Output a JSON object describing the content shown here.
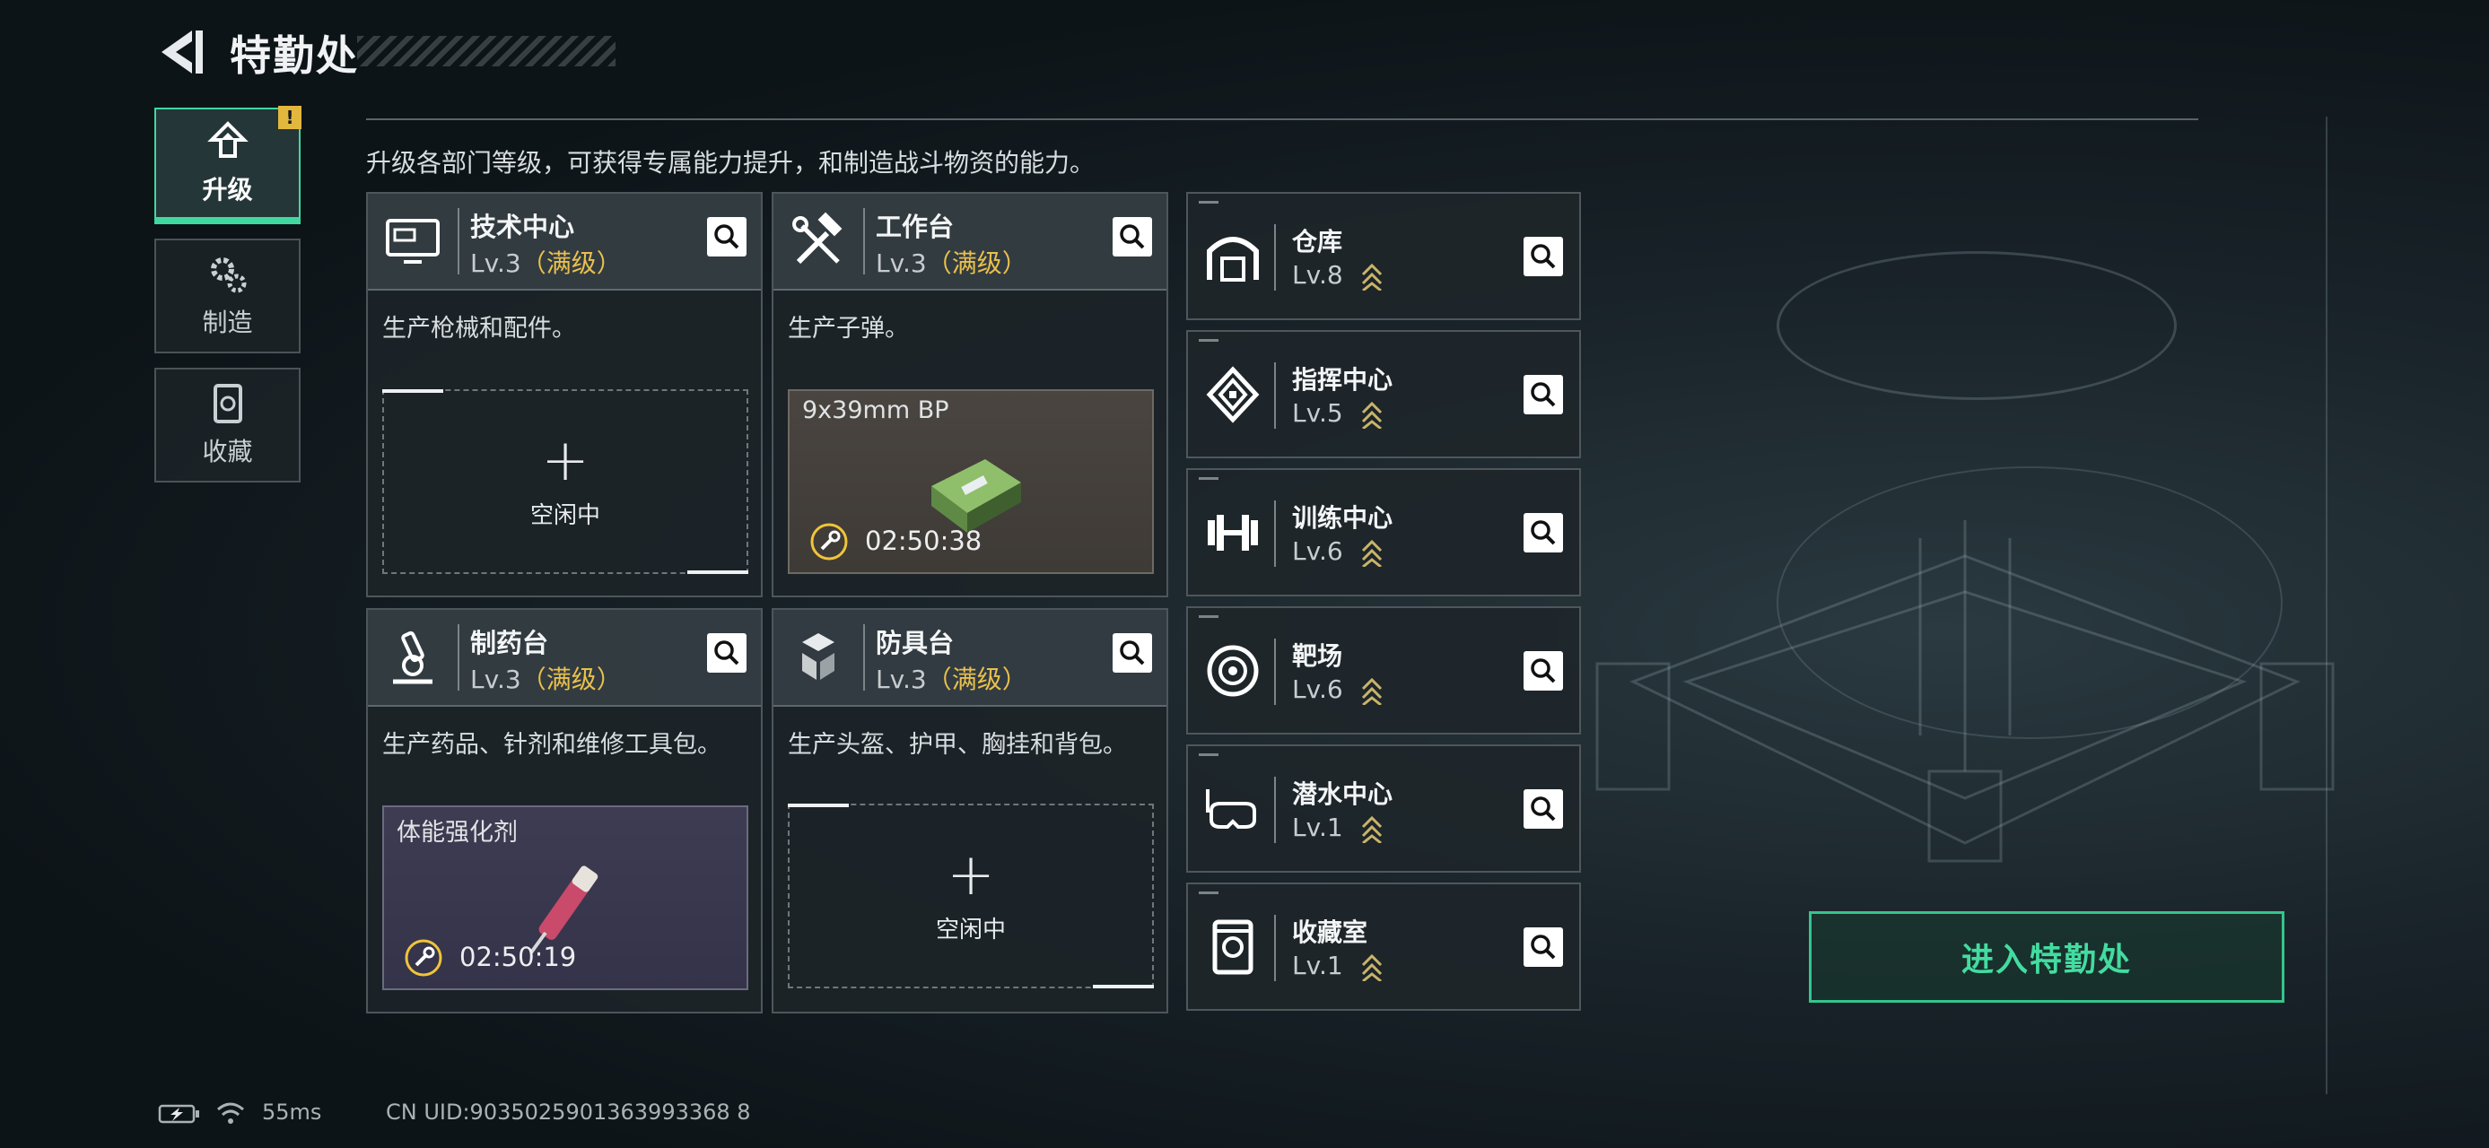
{
  "header": {
    "title": "特勤处"
  },
  "nav": [
    {
      "label": "升级",
      "icon": "upgrade-icon",
      "active": true,
      "badge": "!"
    },
    {
      "label": "制造",
      "icon": "gears-icon",
      "active": false
    },
    {
      "label": "收藏",
      "icon": "collection-icon",
      "active": false
    }
  ],
  "description": "升级各部门等级，可获得专属能力提升，和制造战斗物资的能力。",
  "cards": [
    {
      "name": "技术中心",
      "level": "Lv.3",
      "max": "（满级）",
      "icon": "monitor-icon",
      "desc": "生产枪械和配件。",
      "slot": {
        "state": "idle",
        "text": "空闲中"
      }
    },
    {
      "name": "工作台",
      "level": "Lv.3",
      "max": "（满级）",
      "icon": "tools-icon",
      "desc": "生产子弹。",
      "slot": {
        "state": "producing",
        "item": "9x39mm BP",
        "timer": "02:50:38"
      }
    },
    {
      "name": "制药台",
      "level": "Lv.3",
      "max": "（满级）",
      "icon": "microscope-icon",
      "desc": "生产药品、针剂和维修工具包。",
      "slot": {
        "state": "producing",
        "item": "体能强化剂",
        "timer": "02:50:19"
      }
    },
    {
      "name": "防具台",
      "level": "Lv.3",
      "max": "（满级）",
      "icon": "armor-icon",
      "desc": "生产头盔、护甲、胸挂和背包。",
      "slot": {
        "state": "idle",
        "text": "空闲中"
      }
    }
  ],
  "facilities": [
    {
      "name": "仓库",
      "level": "Lv.8",
      "icon": "warehouse-icon"
    },
    {
      "name": "指挥中心",
      "level": "Lv.5",
      "icon": "command-icon"
    },
    {
      "name": "训练中心",
      "level": "Lv.6",
      "icon": "dumbbell-icon"
    },
    {
      "name": "靶场",
      "level": "Lv.6",
      "icon": "target-icon"
    },
    {
      "name": "潜水中心",
      "level": "Lv.1",
      "icon": "diving-mask-icon"
    },
    {
      "name": "收藏室",
      "level": "Lv.1",
      "icon": "collection-icon"
    }
  ],
  "enter_button": "进入特勤处",
  "status_bar": {
    "ping": "55ms",
    "uid": "CN UID:9035025901363993368 8"
  },
  "colors": {
    "accent": "#41d8a0",
    "max_level": "#e9c04d",
    "alert": "#e2b73d"
  }
}
